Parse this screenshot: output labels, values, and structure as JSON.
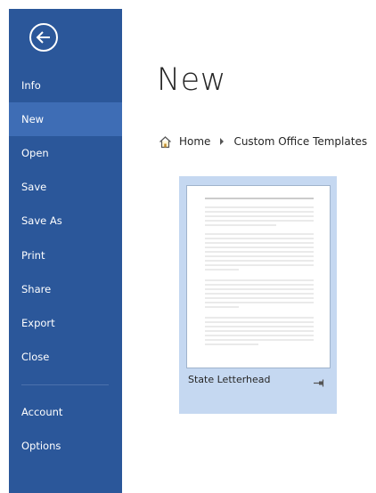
{
  "sidebar": {
    "items": [
      {
        "label": "Info"
      },
      {
        "label": "New"
      },
      {
        "label": "Open"
      },
      {
        "label": "Save"
      },
      {
        "label": "Save As"
      },
      {
        "label": "Print"
      },
      {
        "label": "Share"
      },
      {
        "label": "Export"
      },
      {
        "label": "Close"
      },
      {
        "label": "Account"
      },
      {
        "label": "Options"
      }
    ],
    "selected": "New"
  },
  "main": {
    "title": "New",
    "breadcrumb": {
      "home": "Home",
      "current": "Custom Office Templates"
    },
    "templates": [
      {
        "name": "State Letterhead"
      }
    ]
  },
  "icons": {
    "back": "back-arrow-icon",
    "home": "home-icon",
    "separator": "chevron-right-icon",
    "pin": "pin-icon"
  },
  "colors": {
    "sidebar": "#2b579a",
    "sidebar_selected": "#3e6db5",
    "tile": "#c5d8f1"
  }
}
